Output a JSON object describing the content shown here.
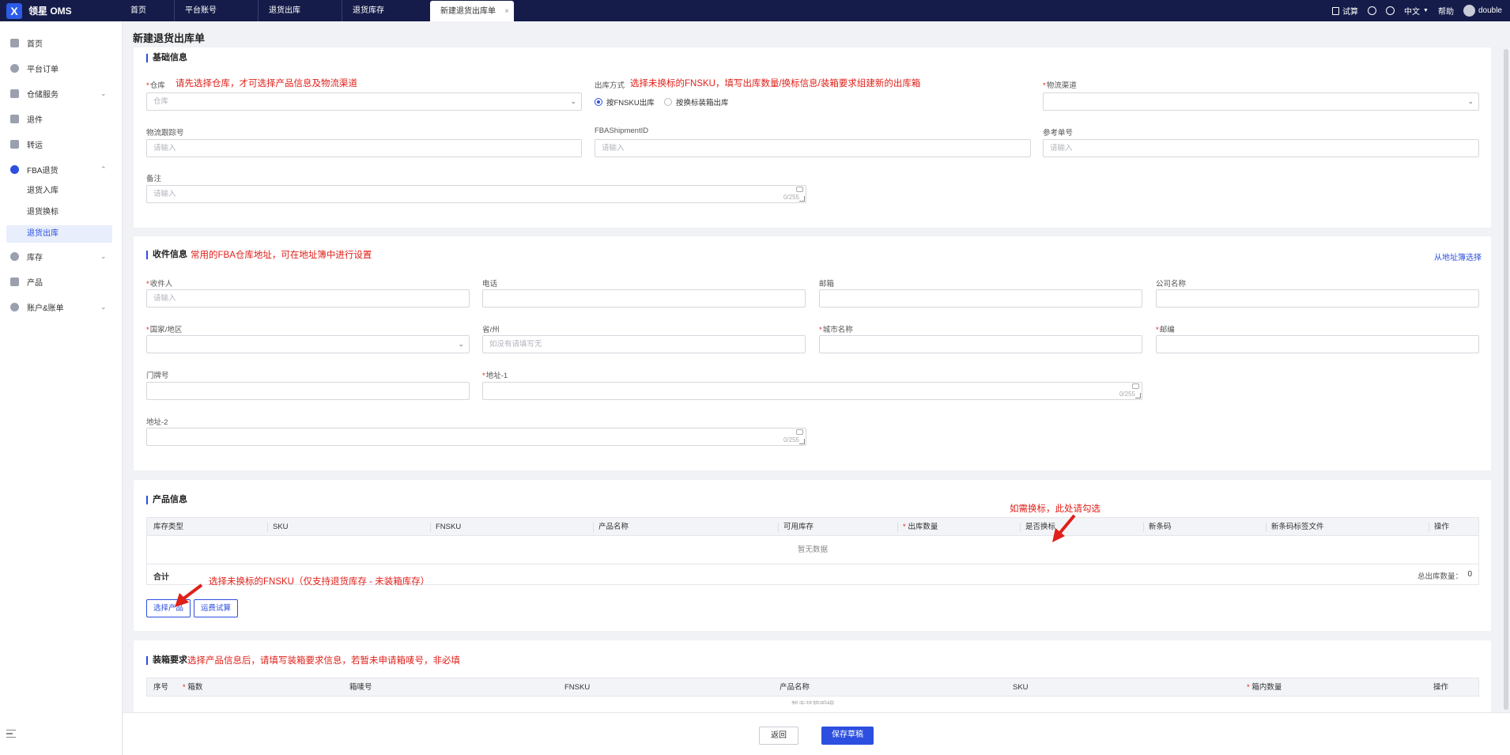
{
  "app": {
    "title": "领星 OMS",
    "logo_glyph": "X"
  },
  "nav_tabs": [
    {
      "label": "首页"
    },
    {
      "label": "平台账号"
    },
    {
      "label": "退货出库"
    },
    {
      "label": "退货库存"
    },
    {
      "label": "新建退货出库单",
      "active": true
    }
  ],
  "topright": {
    "trial": "试算",
    "lang": "中文",
    "help": "帮助",
    "user": "double"
  },
  "sidebar": {
    "items": [
      {
        "label": "首页"
      },
      {
        "label": "平台订单"
      },
      {
        "label": "仓储服务"
      },
      {
        "label": "退件"
      },
      {
        "label": "转运"
      },
      {
        "label": "FBA退货"
      },
      {
        "label": "库存"
      },
      {
        "label": "产品"
      },
      {
        "label": "账户&账单"
      }
    ],
    "sub_items": [
      {
        "label": "退货入库"
      },
      {
        "label": "退货换标"
      },
      {
        "label": "退货出库",
        "active": true
      }
    ]
  },
  "page_title": "新建退货出库单",
  "basic": {
    "title": "基础信息",
    "warehouse_label": "仓库",
    "warehouse_note": "请先选择仓库，才可选择产品信息及物流渠道",
    "warehouse_placeholder": "仓库",
    "outbound_label": "出库方式",
    "outbound_note": "选择未换标的FNSKU，填写出库数量/换标信息/装箱要求组建新的出库箱",
    "radio_fnsku": "按FNSKU出库",
    "radio_box": "按换标装箱出库",
    "channel_label": "物流渠道",
    "tracking_label": "物流跟踪号",
    "tracking_placeholder": "请输入",
    "shipment_label": "FBAShipmentID",
    "shipment_placeholder": "请输入",
    "ref_label": "参考单号",
    "ref_placeholder": "请输入",
    "remark_label": "备注",
    "remark_placeholder": "请输入",
    "remark_count": "0/255"
  },
  "receiver": {
    "title": "收件信息",
    "note": "常用的FBA仓库地址，可在地址簿中进行设置",
    "from_book": "从地址簿选择",
    "name_label": "收件人",
    "name_placeholder": "请输入",
    "phone_label": "电话",
    "email_label": "邮箱",
    "company_label": "公司名称",
    "country_label": "国家/地区",
    "province_label": "省/州",
    "province_placeholder": "如没有请填写无",
    "city_label": "城市名称",
    "zip_label": "邮编",
    "door_label": "门牌号",
    "addr1_label": "地址-1",
    "addr1_count": "0/255",
    "addr2_label": "地址-2",
    "addr2_count": "0/255"
  },
  "product": {
    "title": "产品信息",
    "note_relabel": "如需换标，此处请勾选",
    "columns": [
      "库存类型",
      "SKU",
      "FNSKU",
      "产品名称",
      "可用库存",
      "出库数量",
      "是否换标",
      "新条码",
      "新条码标签文件",
      "操作"
    ],
    "empty": "暂无数据",
    "total_label": "合计",
    "total_qty_label": "总出库数量：",
    "total_qty": "0",
    "select_btn": "选择产品",
    "fee_btn": "运费试算",
    "select_note": "选择未换标的FNSKU（仅支持退货库存 - 未装箱库存）"
  },
  "packing": {
    "title": "装箱要求",
    "note": "选择产品信息后，请填写装箱要求信息，若暂未申请箱唛号，非必填",
    "columns": [
      "序号",
      "箱数",
      "箱唛号",
      "FNSKU",
      "产品名称",
      "SKU",
      "箱内数量",
      "操作"
    ],
    "empty_partial": "暂无装箱明细"
  },
  "footer": {
    "back": "返回",
    "save": "保存草稿"
  },
  "colors": {
    "brand": "#2c4fe0",
    "topbar": "#151c4a",
    "note": "#e0201a"
  }
}
